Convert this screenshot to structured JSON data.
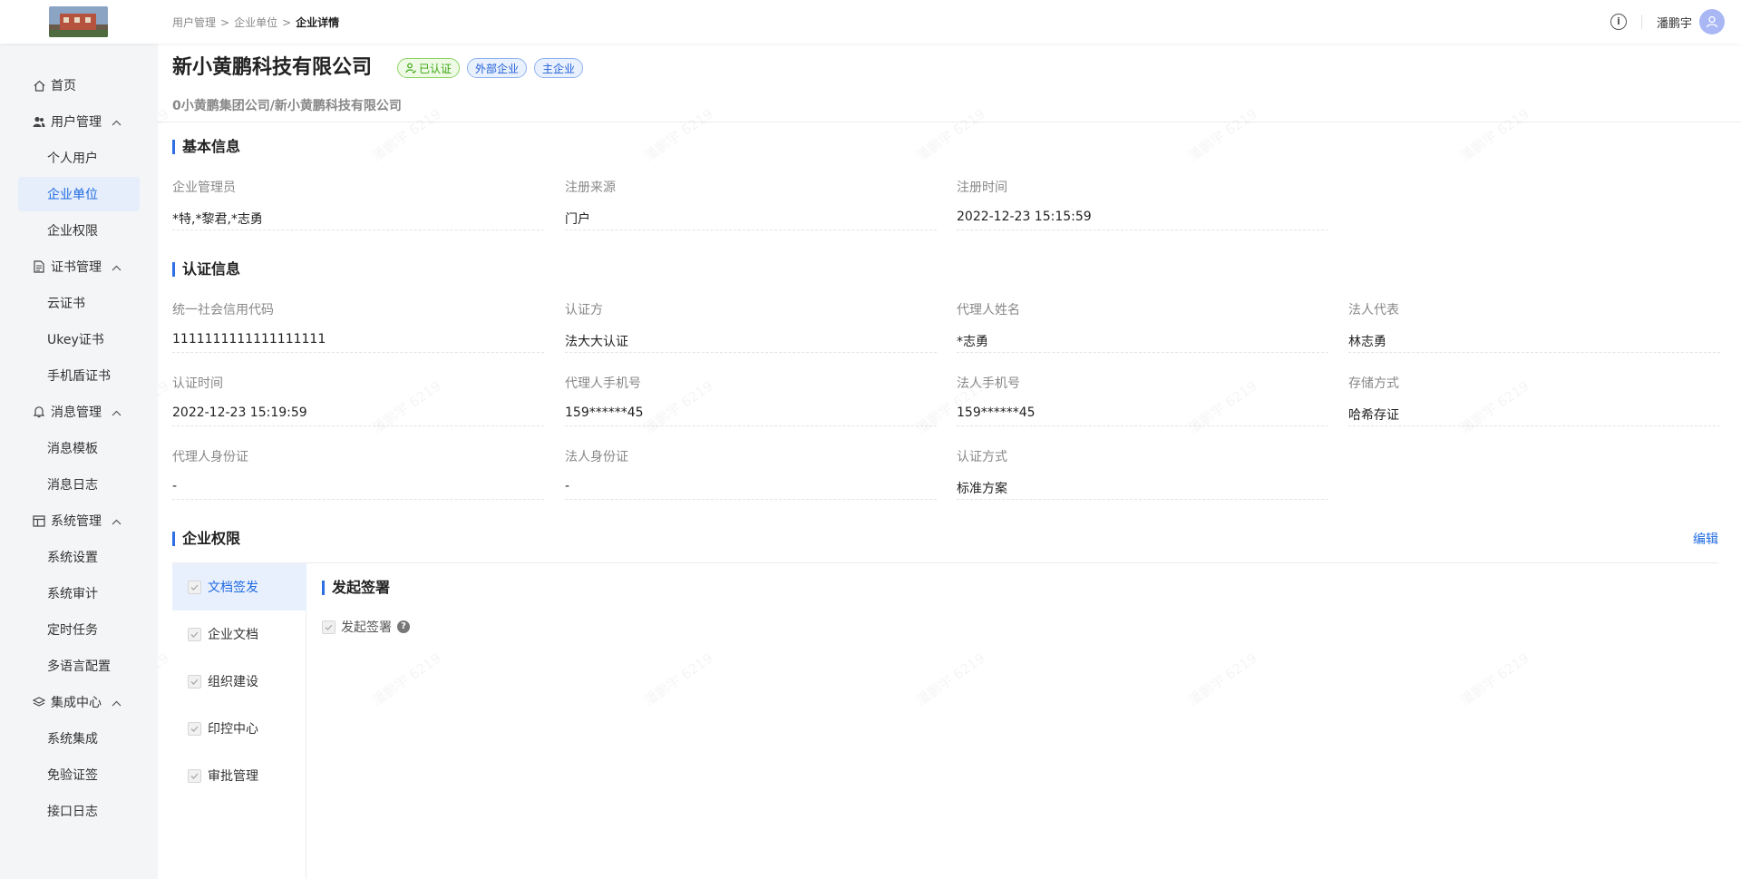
{
  "breadcrumb": {
    "item1": "用户管理",
    "item2": "企业单位",
    "current": "企业详情",
    "separator": ">"
  },
  "user": {
    "name": "潘鹏宇"
  },
  "sidebar": {
    "home": "首页",
    "user_mgmt": "用户管理",
    "personal_users": "个人用户",
    "enterprise_units": "企业单位",
    "enterprise_perms": "企业权限",
    "cert_mgmt": "证书管理",
    "cloud_cert": "云证书",
    "ukey_cert": "Ukey证书",
    "phone_shield_cert": "手机盾证书",
    "msg_mgmt": "消息管理",
    "msg_template": "消息模板",
    "msg_log": "消息日志",
    "sys_mgmt": "系统管理",
    "sys_settings": "系统设置",
    "sys_audit": "系统审计",
    "scheduled_tasks": "定时任务",
    "multilang": "多语言配置",
    "integration": "集成中心",
    "sys_integration": "系统集成",
    "exempt_sign": "免验证签",
    "api_log": "接口日志"
  },
  "company": {
    "name": "新小黄鹏科技有限公司",
    "tags": {
      "certified": "已认证",
      "external": "外部企业",
      "main": "主企业"
    },
    "path": "0小黄鹏集团公司/新小黄鹏科技有限公司"
  },
  "basic_info": {
    "title": "基本信息",
    "admin": {
      "label": "企业管理员",
      "value": "*特,*黎君,*志勇"
    },
    "source": {
      "label": "注册来源",
      "value": "门户"
    },
    "reg_time": {
      "label": "注册时间",
      "value": "2022-12-23 15:15:59"
    }
  },
  "cert_info": {
    "title": "认证信息",
    "credit_code": {
      "label": "统一社会信用代码",
      "value": "1111111111111111111"
    },
    "certifier": {
      "label": "认证方",
      "value": "法大大认证"
    },
    "agent_name": {
      "label": "代理人姓名",
      "value": "*志勇"
    },
    "legal_rep": {
      "label": "法人代表",
      "value": "林志勇"
    },
    "cert_time": {
      "label": "认证时间",
      "value": "2022-12-23 15:19:59"
    },
    "agent_phone": {
      "label": "代理人手机号",
      "value": "159******45"
    },
    "legal_phone": {
      "label": "法人手机号",
      "value": "159******45"
    },
    "storage": {
      "label": "存储方式",
      "value": "哈希存证"
    },
    "agent_id": {
      "label": "代理人身份证",
      "value": "-"
    },
    "legal_id": {
      "label": "法人身份证",
      "value": "-"
    },
    "cert_method": {
      "label": "认证方式",
      "value": "标准方案"
    }
  },
  "permissions": {
    "title": "企业权限",
    "edit": "编辑",
    "items": [
      "文档签发",
      "企业文档",
      "组织建设",
      "印控中心",
      "审批管理"
    ],
    "sub_title": "发起签署",
    "option": "发起签署",
    "help_glyph": "?"
  },
  "watermark": "潘鹏宇 6219",
  "colors": {
    "accent": "#1f6ae0",
    "certified_green": "#3aa60f"
  }
}
